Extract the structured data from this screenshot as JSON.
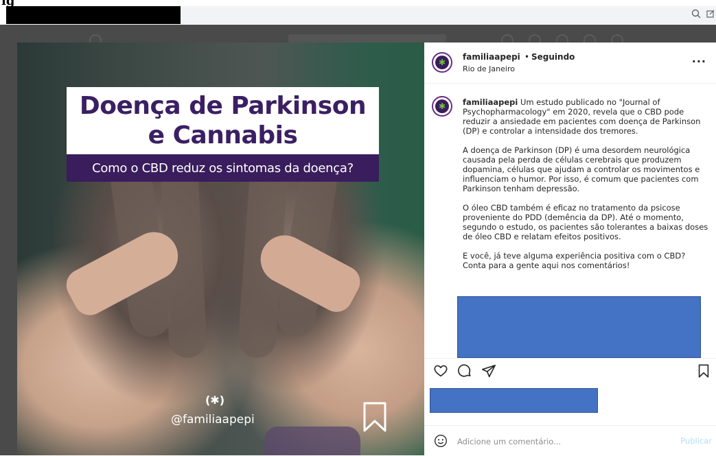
{
  "figure": {
    "label": "ig"
  },
  "post": {
    "username": "familiaapepi",
    "separator": "•",
    "follow_status": "Seguindo",
    "location": "Rio de Janeiro",
    "more_label": "···"
  },
  "image": {
    "title_line1": "Doença de Parkinson",
    "title_line2": "e Cannabis",
    "subtitle": "Como o CBD reduz os sintomas da doença?",
    "watermark_logo": "(✱)",
    "watermark_handle": "@familiaapepi"
  },
  "caption": {
    "username": "familiaapepi",
    "paragraph1": "Um estudo publicado no \"Journal of Psychopharmacology\" em 2020, revela que o CBD pode reduzir a ansiedade em pacientes com doença de Parkinson (DP) e controlar a intensidade dos tremores.",
    "paragraph2": "A doença de Parkinson (DP) é uma desordem neurológica causada pela perda de células cerebrais que produzem dopamina, células que ajudam a controlar os movimentos e influenciam o humor. Por isso, é comum que pacientes com Parkinson tenham depressão.",
    "paragraph3": "O óleo CBD também é eficaz no tratamento da psicose proveniente do PDD (demência da DP). Até o momento, segundo o estudo, os pacientes são tolerantes a baixas doses de óleo CBD e relatam efeitos positivos.",
    "paragraph4": "E você, já teve alguma experiência positiva com o CBD? Conta para a gente aqui nos comentários!"
  },
  "comment": {
    "placeholder": "Adicione um comentário...",
    "publish_label": "Publicar"
  },
  "colors": {
    "brand_purple": "#3a1d5c",
    "redaction_blue": "#4472c4",
    "publish_disabled": "#b2dffc"
  }
}
